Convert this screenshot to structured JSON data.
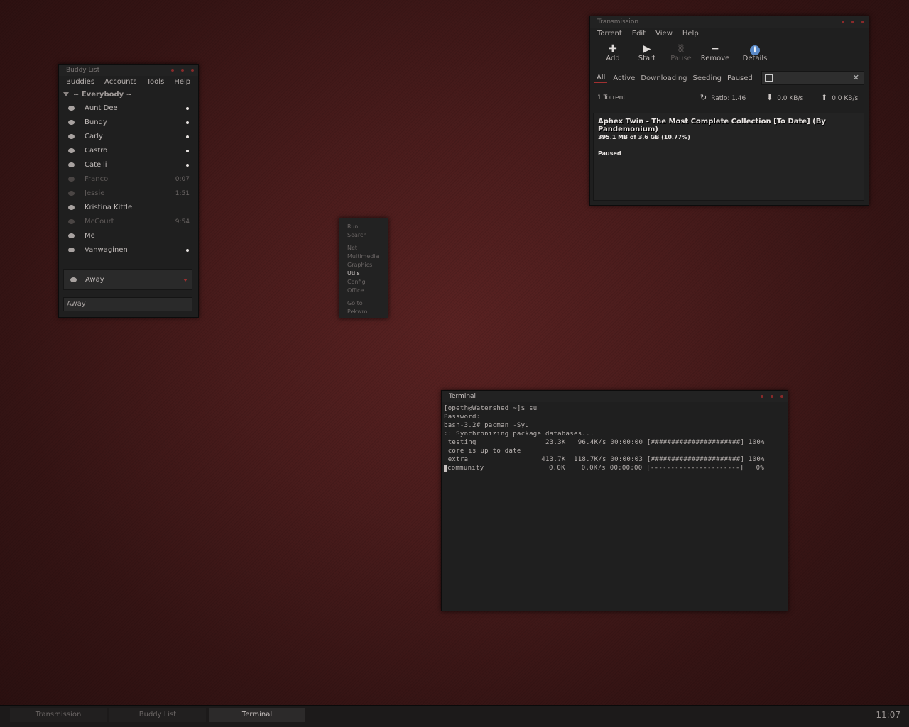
{
  "buddy_list": {
    "title": "Buddy List",
    "menu": [
      "Buddies",
      "Accounts",
      "Tools",
      "Help"
    ],
    "group": "~ Everybody ~",
    "buddies": [
      {
        "name": "Aunt Dee",
        "status": ""
      },
      {
        "name": "Bundy",
        "status": ""
      },
      {
        "name": "Carly",
        "status": ""
      },
      {
        "name": "Castro",
        "status": ""
      },
      {
        "name": "Catelli",
        "status": ""
      },
      {
        "name": "Franco",
        "status": "0:07"
      },
      {
        "name": "Jessie",
        "status": "1:51"
      },
      {
        "name": "Kristina Kittle",
        "status": ""
      },
      {
        "name": "McCourt",
        "status": "9:54"
      },
      {
        "name": "Me",
        "status": ""
      },
      {
        "name": "Vanwaginen",
        "status": ""
      }
    ],
    "status_selector": "Away",
    "away_message": "Away"
  },
  "root_menu": {
    "items": [
      "Run..",
      "Search",
      "Net",
      "Multimedia",
      "Graphics",
      "Utils",
      "Config",
      "Office",
      "Go to",
      "Pekwm"
    ],
    "selected": "Utils"
  },
  "transmission": {
    "title": "Transmission",
    "menu": [
      "Torrent",
      "Edit",
      "View",
      "Help"
    ],
    "toolbar": [
      "Add",
      "Start",
      "Pause",
      "Remove",
      "Details"
    ],
    "filters": [
      "All",
      "Active",
      "Downloading",
      "Seeding",
      "Paused"
    ],
    "torrent_count": "1 Torrent",
    "ratio": "Ratio: 1.46",
    "down_speed": "0.0 KB/s",
    "up_speed": "0.0 KB/s",
    "torrent": {
      "name": "Aphex Twin - The Most Complete Collection [To Date] (By Pandemonium)",
      "size": "395.1 MB of 3.6 GB (10.77%)",
      "status": "Paused"
    }
  },
  "terminal": {
    "title": "Terminal",
    "lines": [
      "[opeth@Watershed ~]$ su",
      "Password:",
      "bash-3.2# pacman -Syu",
      ":: Synchronizing package databases...",
      " testing                 23.3K   96.4K/s 00:00:00 [######################] 100%",
      " core is up to date",
      " extra                  413.7K  118.7K/s 00:00:03 [######################] 100%",
      "community                0.0K    0.0K/s 00:00:00 [----------------------]   0%"
    ]
  },
  "taskbar": {
    "tasks": [
      "Transmission",
      "Buddy List",
      "Terminal"
    ],
    "active": "Terminal",
    "clock": "11:07"
  }
}
